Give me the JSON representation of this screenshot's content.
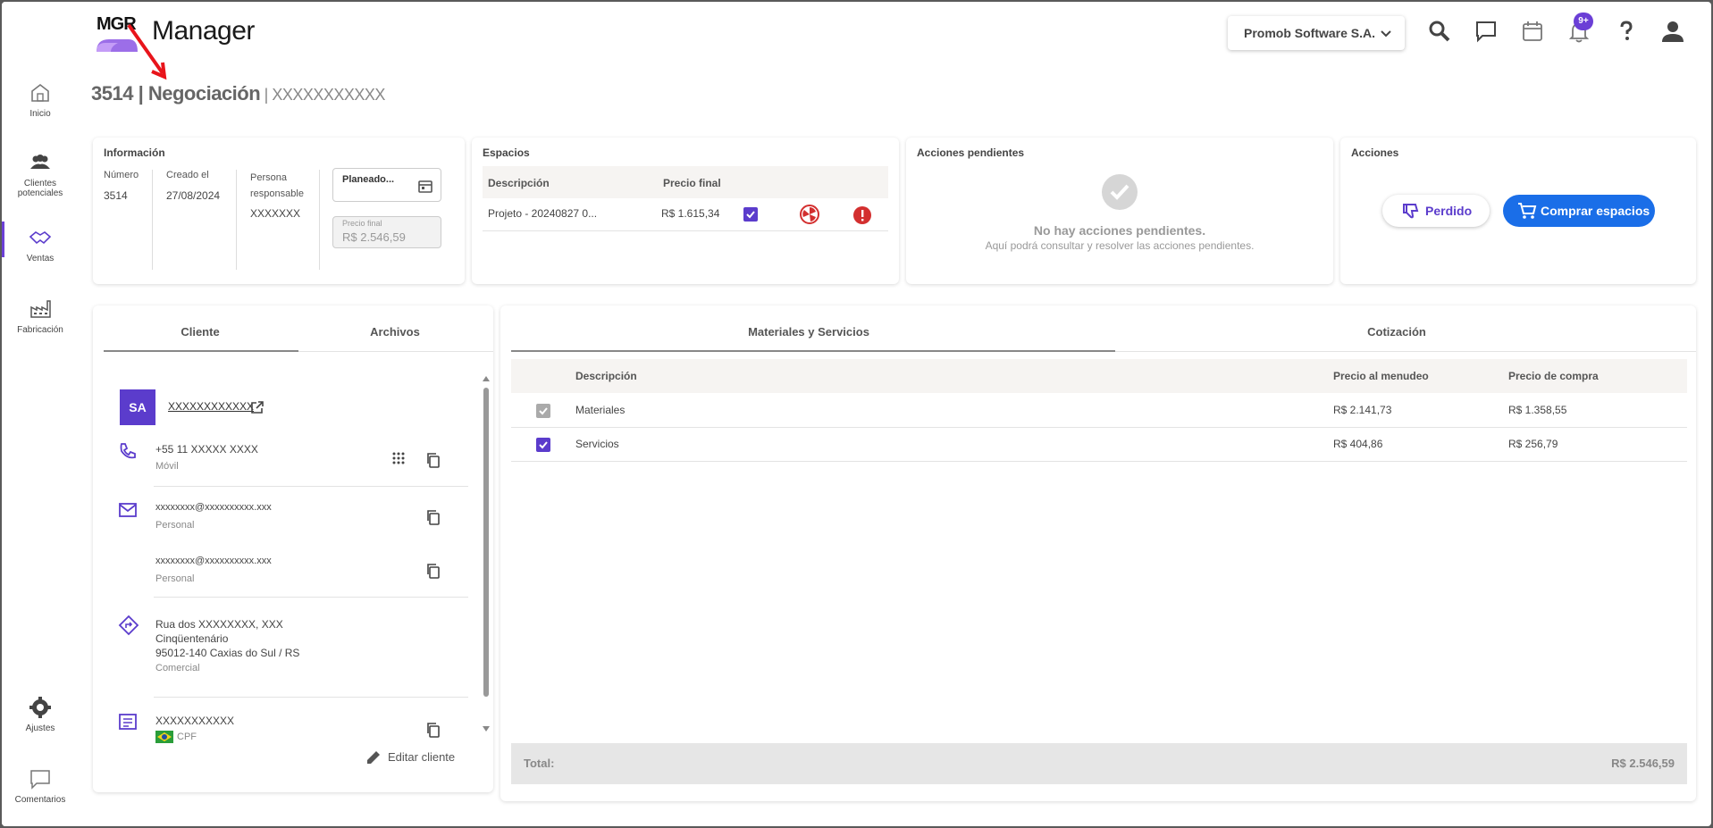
{
  "app": {
    "logo_mark": "MGR",
    "name": "Manager"
  },
  "sidebar": {
    "items": [
      {
        "label": "Inicio",
        "icon": "home-icon"
      },
      {
        "label": "Clientes potenciales",
        "icon": "people-icon"
      },
      {
        "label": "Ventas",
        "icon": "handshake-icon",
        "active": true
      },
      {
        "label": "Fabricación",
        "icon": "factory-icon"
      },
      {
        "label": "Ajustes",
        "icon": "gear-icon"
      },
      {
        "label": "Comentarios",
        "icon": "comment-icon"
      }
    ]
  },
  "topbar": {
    "company": "Promob Software S.A.",
    "notifications_badge": "9+"
  },
  "page": {
    "number": "3514",
    "sep": " | ",
    "title": "Negociación",
    "sep2": " | ",
    "subtitle": "XXXXXXXXXXX"
  },
  "info": {
    "title": "Información",
    "number_label": "Número",
    "number_value": "3514",
    "created_label": "Creado el",
    "created_value": "27/08/2024",
    "responsible_label": "Persona responsable",
    "responsible_value": "XXXXXXX",
    "status_label": "Planeado...",
    "final_price_label": "Precio final",
    "final_price_value": "R$ 2.546,59"
  },
  "spaces": {
    "title": "Espacios",
    "col_description": "Descripción",
    "col_final_price": "Precio final",
    "rows": [
      {
        "description": "Projeto - 20240827 0...",
        "price": "R$ 1.615,34"
      }
    ]
  },
  "pending": {
    "title": "Acciones pendientes",
    "empty_title": "No hay acciones pendientes.",
    "empty_sub": "Aquí podrá consultar y resolver las acciones pendientes."
  },
  "actions": {
    "title": "Acciones",
    "lost_label": "Perdido",
    "buy_label": "Comprar espacios"
  },
  "left_tabs": {
    "client": "Cliente",
    "files": "Archivos"
  },
  "client": {
    "avatar": "SA",
    "name": "XXXXXXXXXXXX",
    "phone": "+55 11 XXXXX XXXX",
    "phone_type": "Móvil",
    "email1": "xxxxxxxx@xxxxxxxxxx.xxx",
    "email1_type": "Personal",
    "email2": "xxxxxxxx@xxxxxxxxxx.xxx",
    "email2_type": "Personal",
    "address_line1": "Rua dos XXXXXXXX, XXX",
    "address_line2": "Cinqüentenário",
    "address_line3": "95012-140 Caxias do Sul / RS",
    "address_type": "Comercial",
    "doc": "XXXXXXXXXXX",
    "doc_type": "CPF",
    "edit_label": "Editar cliente"
  },
  "right_tabs": {
    "materials": "Materiales y Servicios",
    "quote": "Cotización"
  },
  "materials": {
    "col_description": "Descripción",
    "col_retail": "Precio al menudeo",
    "col_purchase": "Precio de compra",
    "rows": [
      {
        "description": "Materiales",
        "retail": "R$ 2.141,73",
        "purchase": "R$ 1.358,55"
      },
      {
        "description": "Servicios",
        "retail": "R$ 404,86",
        "purchase": "R$ 256,79"
      }
    ],
    "total_label": "Total:",
    "total_value": "R$ 2.546,59"
  },
  "colors": {
    "accent": "#5b3ccc",
    "primary_button": "#1a6ee8",
    "annotation": "#e8141b"
  }
}
